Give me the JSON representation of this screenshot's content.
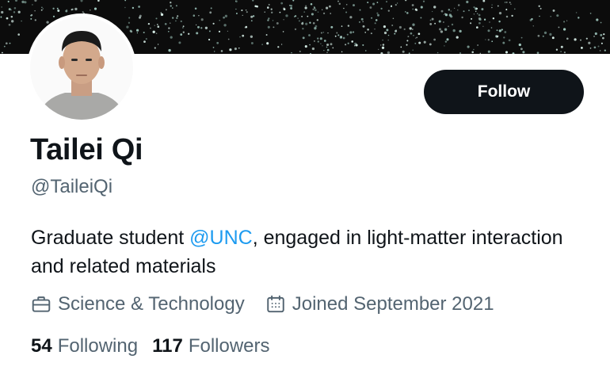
{
  "profile": {
    "display_name": "Tailei Qi",
    "handle": "@TaileiQi",
    "bio": {
      "before": "Graduate student ",
      "mention": "@UNC",
      "after": ", engaged in light-matter interaction and related materials"
    },
    "category": "Science & Technology",
    "joined": "Joined September 2021",
    "following": {
      "count": "54",
      "label": "Following"
    },
    "followers": {
      "count": "117",
      "label": "Followers"
    }
  },
  "actions": {
    "follow_label": "Follow"
  },
  "icons": {
    "category": "briefcase-icon",
    "joined": "calendar-icon"
  },
  "colors": {
    "text_primary": "#0f1419",
    "text_secondary": "#536471",
    "link": "#1d9bf0",
    "button_bg": "#0f1419",
    "banner_bg": "#0c0c0c"
  }
}
